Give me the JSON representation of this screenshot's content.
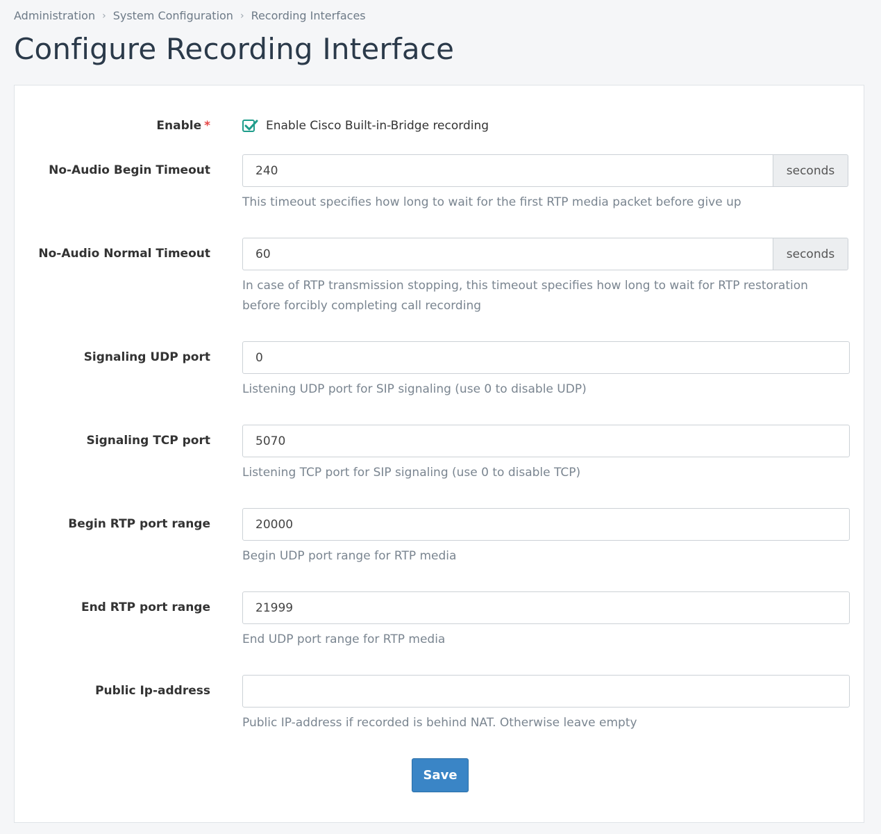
{
  "breadcrumb": [
    "Administration",
    "System Configuration",
    "Recording Interfaces"
  ],
  "page_title": "Configure Recording Interface",
  "form": {
    "enable": {
      "label": "Enable",
      "required_mark": "*",
      "checked": true,
      "checkbox_label": "Enable Cisco Built-in-Bridge recording"
    },
    "no_audio_begin": {
      "label": "No-Audio Begin Timeout",
      "value": "240",
      "unit": "seconds",
      "help": "This timeout specifies how long to wait for the first RTP media packet before give up"
    },
    "no_audio_normal": {
      "label": "No-Audio Normal Timeout",
      "value": "60",
      "unit": "seconds",
      "help_line1": "In case of RTP transmission stopping, this timeout specifies how long to wait for RTP restoration",
      "help_line2": "before forcibly completing call recording"
    },
    "udp_port": {
      "label": "Signaling UDP port",
      "value": "0",
      "help": "Listening UDP port for SIP signaling (use 0 to disable UDP)"
    },
    "tcp_port": {
      "label": "Signaling TCP port",
      "value": "5070",
      "help": "Listening TCP port for SIP signaling (use 0 to disable TCP)"
    },
    "rtp_begin": {
      "label": "Begin RTP port range",
      "value": "20000",
      "help": "Begin UDP port range for RTP media"
    },
    "rtp_end": {
      "label": "End RTP port range",
      "value": "21999",
      "help": "End UDP port range for RTP media"
    },
    "public_ip": {
      "label": "Public Ip-address",
      "value": "",
      "help": "Public IP-address if recorded is behind NAT. Otherwise leave empty"
    }
  },
  "save_label": "Save",
  "colors": {
    "accent": "#3a85c6",
    "checkbox": "#1f9d8b",
    "required": "#e64545",
    "title": "#2b3a4a"
  }
}
